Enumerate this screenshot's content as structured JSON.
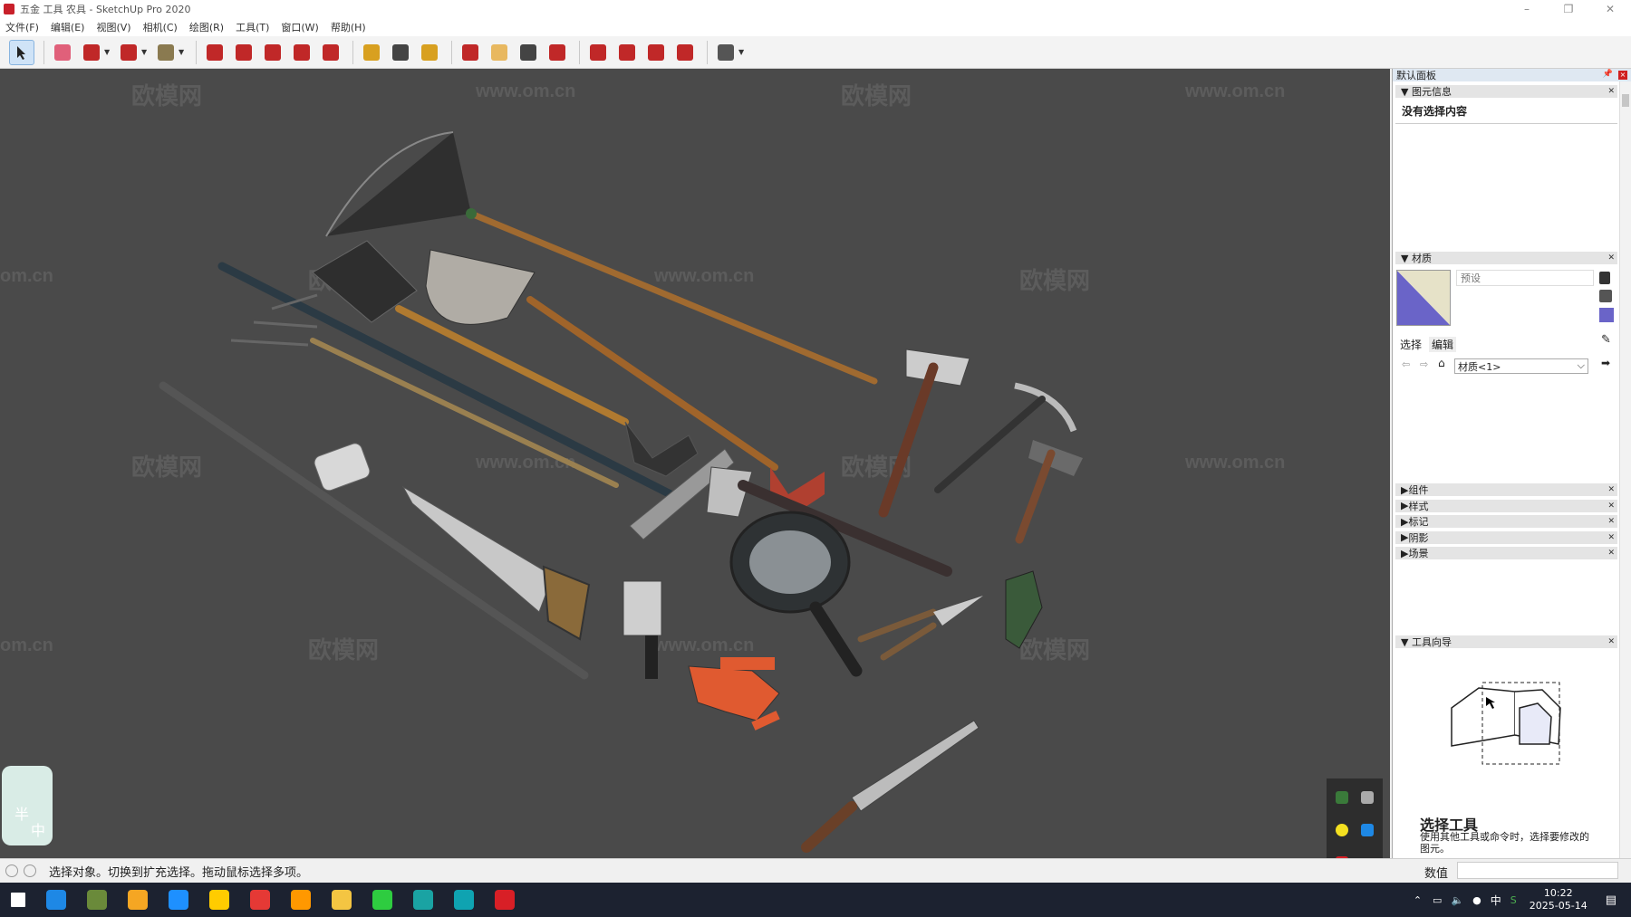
{
  "window": {
    "title": "五金 工具 农具 - SketchUp Pro 2020",
    "controls": {
      "minimize": "–",
      "restore": "❐",
      "close": "✕"
    }
  },
  "menu": [
    "文件(F)",
    "编辑(E)",
    "视图(V)",
    "相机(C)",
    "绘图(R)",
    "工具(T)",
    "窗口(W)",
    "帮助(H)"
  ],
  "toolbar": {
    "tools": [
      {
        "name": "select-tool",
        "icon": "arrow-cursor-icon",
        "color": "#222222",
        "active": true
      },
      {
        "name": "eraser-tool",
        "icon": "eraser-icon",
        "color": "#e0607a"
      },
      {
        "name": "line-tool",
        "icon": "pencil-icon",
        "color": "#c02828",
        "dropdown": true
      },
      {
        "name": "arc-tool",
        "icon": "arc-icon",
        "color": "#c02828",
        "dropdown": true
      },
      {
        "name": "shape-tool",
        "icon": "circle-icon",
        "color": "#8a7a50",
        "dropdown": true
      },
      {
        "name": "push-pull-tool",
        "icon": "push-pull-icon",
        "color": "#c02828"
      },
      {
        "name": "follow-me-tool",
        "icon": "follow-me-icon",
        "color": "#c02828"
      },
      {
        "name": "move-tool",
        "icon": "move-icon",
        "color": "#c02828"
      },
      {
        "name": "rotate-tool",
        "icon": "rotate-icon",
        "color": "#c02828"
      },
      {
        "name": "scale-tool",
        "icon": "scale-icon",
        "color": "#c02828"
      },
      {
        "name": "tape-measure-tool",
        "icon": "tape-measure-icon",
        "color": "#d8a020"
      },
      {
        "name": "text-tool",
        "icon": "text-icon",
        "color": "#444444"
      },
      {
        "name": "paint-bucket-tool",
        "icon": "paint-bucket-icon",
        "color": "#d8a020"
      },
      {
        "name": "orbit-tool",
        "icon": "orbit-icon",
        "color": "#c02828"
      },
      {
        "name": "pan-tool",
        "icon": "hand-icon",
        "color": "#e8b860"
      },
      {
        "name": "zoom-tool",
        "icon": "magnifier-icon",
        "color": "#444444"
      },
      {
        "name": "zoom-extents-tool",
        "icon": "zoom-extents-icon",
        "color": "#c02828"
      },
      {
        "name": "warehouse-tool",
        "icon": "warehouse-icon",
        "color": "#c02828"
      },
      {
        "name": "extension-warehouse-tool",
        "icon": "extension-warehouse-icon",
        "color": "#c02828"
      },
      {
        "name": "send-to-layout-tool",
        "icon": "layout-icon",
        "color": "#c02828"
      },
      {
        "name": "extension-manager-tool",
        "icon": "ruby-icon",
        "color": "#c02828"
      },
      {
        "name": "account-tool",
        "icon": "user-icon",
        "color": "#555555",
        "dropdown": true
      }
    ]
  },
  "viewport": {
    "background": "#4a4a4a",
    "watermark_large": "欧模网",
    "watermark_url": "www.om.cn",
    "watermark_edge": "om.cn",
    "ime": {
      "char1": "半",
      "char2": "中"
    }
  },
  "tray": {
    "title": "默认面板",
    "entity_info": {
      "header": "图元信息",
      "content": "没有选择内容"
    },
    "materials": {
      "header": "材质",
      "name_placeholder": "预设",
      "tab_select": "选择",
      "tab_edit": "编辑",
      "library": "材质<1>",
      "swatch_color": "#6a64c8"
    },
    "sections": [
      "组件",
      "样式",
      "标记",
      "阴影",
      "场景"
    ],
    "instructor": {
      "header": "工具向导",
      "tool_title": "选择工具",
      "tool_desc": "使用其他工具或命令时，选择要修改的图元。"
    }
  },
  "statusbar": {
    "text": "选择对象。切换到扩充选择。拖动鼠标选择多项。",
    "measure_label": "数值"
  },
  "taskbar": {
    "apps": [
      {
        "name": "start",
        "color": "#ffffff"
      },
      {
        "name": "ie",
        "color": "#1e88e5"
      },
      {
        "name": "minecraft",
        "color": "#6a8a3a"
      },
      {
        "name": "media",
        "color": "#f5a623"
      },
      {
        "name": "security",
        "color": "#1e90ff"
      },
      {
        "name": "player",
        "color": "#ffcc00"
      },
      {
        "name": "chrome",
        "color": "#e53935"
      },
      {
        "name": "sublime",
        "color": "#ff9800"
      },
      {
        "name": "explorer",
        "color": "#f4c542"
      },
      {
        "name": "wechat",
        "color": "#2ecc40"
      },
      {
        "name": "3dsmax",
        "color": "#1aa3a3"
      },
      {
        "name": "edge",
        "color": "#0fa3b1"
      },
      {
        "name": "sketchup",
        "color": "#d81f26"
      }
    ],
    "ime_char": "中",
    "time": "10:22",
    "date": "2025-05-14"
  }
}
